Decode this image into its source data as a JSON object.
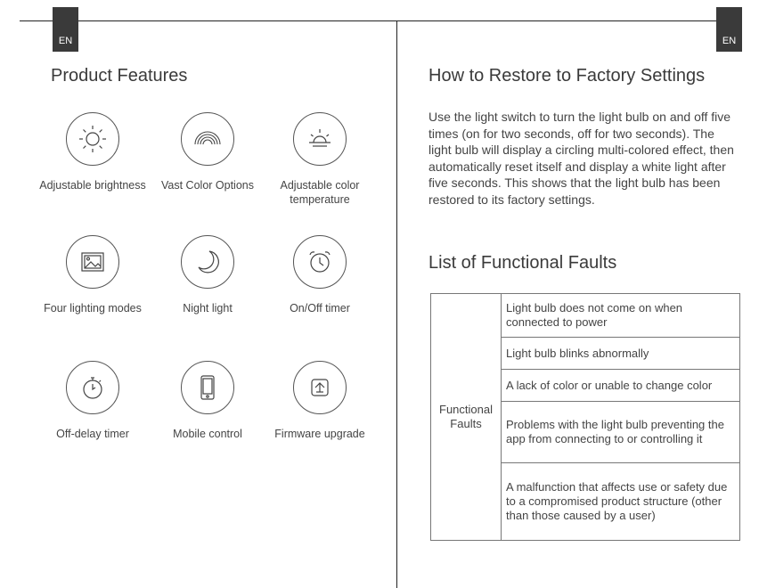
{
  "left": {
    "lang_tab": "EN",
    "title": "Product Features",
    "features": [
      {
        "label": "Adjustable brightness",
        "icon": "sun-icon"
      },
      {
        "label": "Vast Color Options",
        "icon": "rainbow-icon"
      },
      {
        "label": "Adjustable color temperature",
        "icon": "sunrise-icon"
      },
      {
        "label": "Four lighting modes",
        "icon": "picture-icon"
      },
      {
        "label": "Night light",
        "icon": "moon-icon"
      },
      {
        "label": "On/Off timer",
        "icon": "alarm-clock-icon"
      },
      {
        "label": "Off-delay timer",
        "icon": "stopwatch-icon"
      },
      {
        "label": "Mobile control",
        "icon": "phone-icon"
      },
      {
        "label": "Firmware upgrade",
        "icon": "upgrade-icon"
      }
    ]
  },
  "right": {
    "lang_tab": "EN",
    "restore_title": "How to Restore to Factory Settings",
    "restore_text": "Use the light switch to turn the light bulb on and off five times (on for two seconds, off for two seconds). The light bulb will display a circling multi-colored effect, then automatically reset itself and display a white light after five seconds. This shows that the light bulb has been restored to its factory settings.",
    "faults_title": "List of Functional Faults",
    "faults_category": "Functional Faults",
    "faults": [
      "Light bulb does not come on when connected to power",
      "Light bulb blinks abnormally",
      "A lack of color or unable to change color",
      "Problems with the light bulb preventing the app from connecting to or controlling it",
      "A malfunction that affects use or safety due to a compromised product structure (other than those caused by a user)"
    ]
  }
}
